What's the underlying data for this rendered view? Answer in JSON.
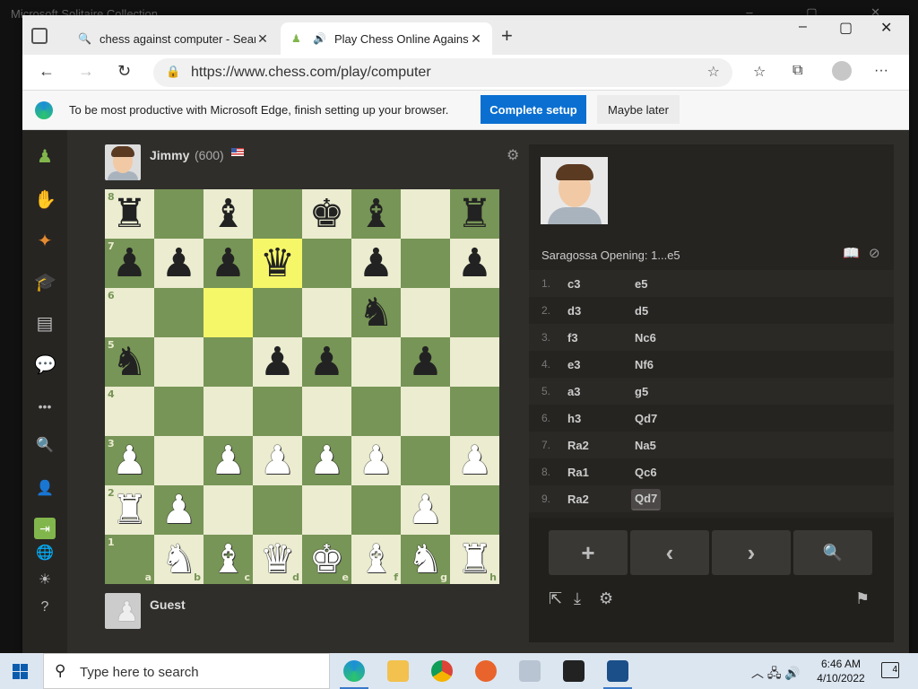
{
  "background_window": {
    "title": "Microsoft Solitaire Collection"
  },
  "tabs": [
    {
      "title": "chess against computer - Search",
      "active": false
    },
    {
      "title": "Play Chess Online Against t",
      "active": true
    }
  ],
  "address": {
    "url": "https://www.chess.com/play/computer"
  },
  "notice": {
    "message": "To be most productive with Microsoft Edge, finish setting up your browser.",
    "setup": "Complete setup",
    "later": "Maybe later"
  },
  "top_player": {
    "name": "Jimmy",
    "rating": "(600)"
  },
  "bottom_player": {
    "name": "Guest"
  },
  "board": {
    "ranks": [
      "8",
      "7",
      "6",
      "5",
      "4",
      "3",
      "2",
      "1"
    ],
    "files": [
      "a",
      "b",
      "c",
      "d",
      "e",
      "f",
      "g",
      "h"
    ],
    "rows": [
      [
        "br",
        "",
        "bb",
        "",
        "bk",
        "bb",
        "",
        "br"
      ],
      [
        "bp",
        "bp",
        "bp",
        "bq",
        "",
        "bp",
        "",
        "bp"
      ],
      [
        "",
        "",
        "",
        "",
        "",
        "bn",
        "",
        ""
      ],
      [
        "bn",
        "",
        "",
        "bp",
        "bp",
        "",
        "bp",
        ""
      ],
      [
        "",
        "",
        "",
        "",
        "",
        "",
        "",
        ""
      ],
      [
        "wp",
        "",
        "wp",
        "wp",
        "wp",
        "wp",
        "",
        "wp"
      ],
      [
        "wr",
        "wp",
        "",
        "",
        "",
        "",
        "wp",
        ""
      ],
      [
        "",
        "wn",
        "wb",
        "wq",
        "wk",
        "wb",
        "wn",
        "wr"
      ]
    ],
    "highlight": [
      "c6",
      "d7"
    ],
    "light_color": "#ebecd0",
    "dark_color": "#779556",
    "highlight_color": "#f6f669"
  },
  "panel": {
    "opening": "Saragossa Opening: 1...e5",
    "moves": [
      {
        "num": "1.",
        "white": "c3",
        "black": "e5"
      },
      {
        "num": "2.",
        "white": "d3",
        "black": "d5"
      },
      {
        "num": "3.",
        "white": "f3",
        "black": "Nc6"
      },
      {
        "num": "4.",
        "white": "e3",
        "black": "Nf6"
      },
      {
        "num": "5.",
        "white": "a3",
        "black": "g5"
      },
      {
        "num": "6.",
        "white": "h3",
        "black": "Qd7"
      },
      {
        "num": "7.",
        "white": "Ra2",
        "black": "Na5"
      },
      {
        "num": "8.",
        "white": "Ra1",
        "black": "Qc6"
      },
      {
        "num": "9.",
        "white": "Ra2",
        "black": "Qd7"
      }
    ],
    "current_move": "9b",
    "controls": {
      "add": "+",
      "prev": "‹",
      "next": "›",
      "analyze": "🔍"
    }
  },
  "taskbar": {
    "search_placeholder": "Type here to search",
    "time": "6:46 AM",
    "date": "4/10/2022",
    "notifications": "4"
  },
  "icons": {
    "chess": "♟",
    "search": "🔍",
    "more": "•••",
    "share": "⇱",
    "download": "⤓",
    "gear": "⚙",
    "flag": "⚑"
  },
  "colors": {
    "accent_green": "#81b64c",
    "edge_blue": "#0a6fd1",
    "page_bg": "#302e2b"
  }
}
